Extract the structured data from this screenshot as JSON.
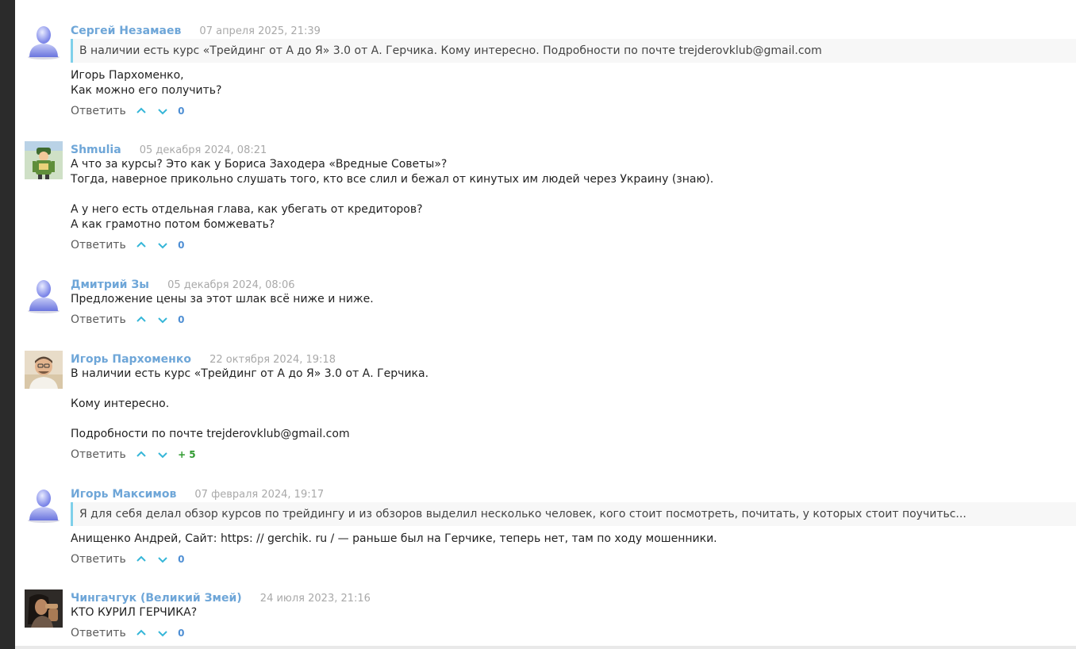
{
  "labels": {
    "reply": "Ответить"
  },
  "comments": [
    {
      "author": "Сергей Незамаев",
      "date": "07 апреля 2025, 21:39",
      "avatar": "default-user-icon",
      "quote": "В наличии есть курс «Трейдинг от А до Я» 3.0 от А. Герчика. Кому интересно. Подробности по почте trejderovklub@gmail.com",
      "lines": [
        "Игорь Пархоменко,",
        "Как можно его получить?"
      ],
      "score": "0"
    },
    {
      "author": "Shmulia",
      "date": "05 декабря 2024, 08:21",
      "avatar": "cartoon-avatar",
      "lines": [
        "А что за курсы? Это как у Бориса Заходера «Вредные Советы»?",
        "Тогда, наверное прикольно слушать того, кто все слил и бежал от кинутых им людей через Украину (знаю).",
        "",
        "А у него есть отдельная глава, как убегать от кредиторов?",
        "А как грамотно потом бомжевать?"
      ],
      "score": "0"
    },
    {
      "author": "Дмитрий Зы",
      "date": "05 декабря 2024, 08:06",
      "avatar": "default-user-icon",
      "lines": [
        "Предложение цены за этот шлак всё ниже и ниже."
      ],
      "score": "0"
    },
    {
      "author": "Игорь Пархоменко",
      "date": "22 октября 2024, 19:18",
      "avatar": "photo-avatar",
      "lines": [
        "В наличии есть курс «Трейдинг от А до Я» 3.0 от А. Герчика.",
        "",
        "Кому интересно.",
        "",
        "Подробности по почте trejderovklub@gmail.com"
      ],
      "score": "+ 5"
    },
    {
      "author": "Игорь Максимов",
      "date": "07 февраля 2024, 19:17",
      "avatar": "default-user-icon",
      "quote": "Я для себя делал обзор курсов по трейдингу и из обзоров выделил несколько человек, кого стоит посмотреть, почитать, у которых стоит поучитьс...",
      "lines": [
        "Анищенко Андрей, Сайт: https: // gerchik. ru / — раньше был на Герчике, теперь нет, там по ходу мошенники."
      ],
      "score": "0"
    },
    {
      "author": "Чингачгук (Великий Змей)",
      "date": "24 июля 2023, 21:16",
      "avatar": "photo-avatar",
      "lines": [
        "КТО КУРИЛ ГЕРЧИКА?"
      ],
      "score": "0"
    }
  ],
  "colors": {
    "author": "#6ea6d8",
    "date": "#a9a9a9",
    "vote_arrows": "#36b6d8",
    "score_neutral": "#4f8fd4",
    "score_positive": "#2f9a2f",
    "quote_border": "#7fd0ea"
  }
}
